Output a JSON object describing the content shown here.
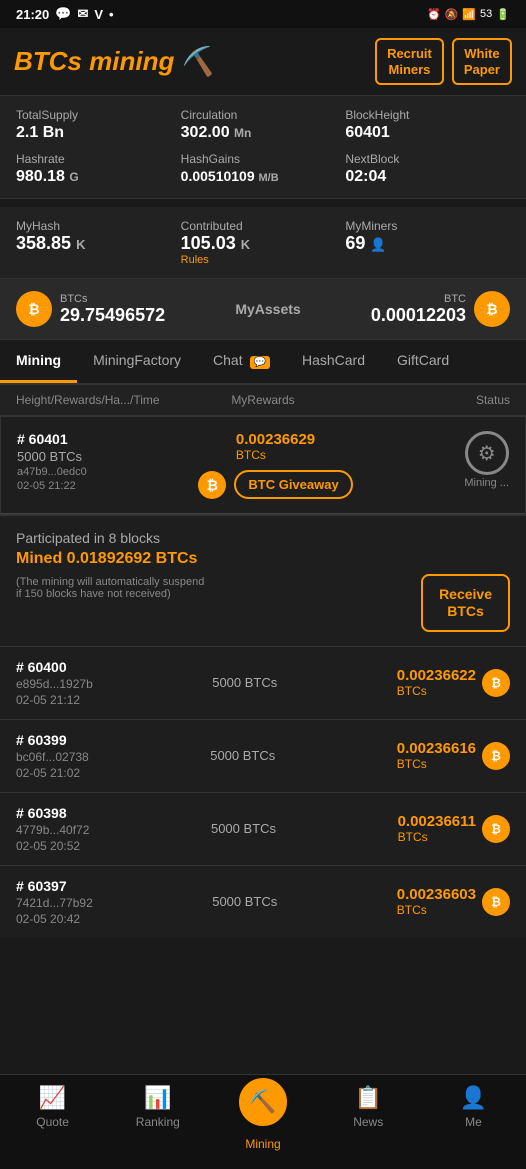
{
  "statusBar": {
    "time": "21:20",
    "icons": [
      "whatsapp",
      "message",
      "vpn",
      "dot",
      "alarm",
      "bell-off",
      "signal",
      "battery"
    ],
    "battery": "53"
  },
  "header": {
    "logo": "BTCs mining",
    "logo_emoji": "⛏️",
    "buttons": [
      {
        "id": "recruit-miners",
        "label": "Recruit\nMiners"
      },
      {
        "id": "white-paper",
        "label": "White\nPaper"
      }
    ]
  },
  "stats": [
    {
      "label": "TotalSupply",
      "value": "2.1 Bn",
      "unit": ""
    },
    {
      "label": "Circulation",
      "value": "302.00",
      "unit": "Mn"
    },
    {
      "label": "BlockHeight",
      "value": "60401",
      "unit": ""
    },
    {
      "label": "Hashrate",
      "value": "980.18",
      "unit": "G"
    },
    {
      "label": "HashGains",
      "value": "0.00510109",
      "unit": "M/B"
    },
    {
      "label": "NextBlock",
      "value": "02:04",
      "unit": ""
    }
  ],
  "mySection": [
    {
      "label": "MyHash",
      "value": "358.85",
      "unit": "K"
    },
    {
      "label": "Contributed",
      "value": "105.03",
      "unit": "K",
      "sub": "Rules"
    },
    {
      "label": "MyMiners",
      "value": "69",
      "unit": "👤"
    }
  ],
  "assets": {
    "left_label": "BTCs",
    "left_value": "29.75496572",
    "center_label": "MyAssets",
    "right_label": "BTC",
    "right_value": "0.00012203"
  },
  "tabs": [
    {
      "id": "mining",
      "label": "Mining",
      "active": true
    },
    {
      "id": "mining-factory",
      "label": "MiningFactory"
    },
    {
      "id": "chat",
      "label": "Chat",
      "badge": "💬"
    },
    {
      "id": "hashcard",
      "label": "HashCard"
    },
    {
      "id": "giftcard",
      "label": "GiftCard"
    }
  ],
  "subHeaders": [
    {
      "label": "Height/Rewards/Ha.../Time"
    },
    {
      "label": "MyRewards"
    },
    {
      "label": "Status"
    }
  ],
  "highlightedBlock": {
    "id": "#60401",
    "btcs": "5000 BTCs",
    "hash": "a47b9...0edc0",
    "time": "02-05 21:22",
    "amount": "0.00236629",
    "unit": "BTCs",
    "giveaway_label": "BTC Giveaway"
  },
  "participatedSection": {
    "label": "Participated in 8 blocks",
    "mined": "Mined 0.01892692 BTCs",
    "note": "(The mining will automatically suspend\nif 150 blocks have not received)",
    "button": "Receive\nBTCs"
  },
  "miningRows": [
    {
      "id": "#60400",
      "hash": "e895d...1927b",
      "btcs": "5000 BTCs",
      "time": "02-05 21:12",
      "amount": "0.00236622",
      "unit": "BTCs"
    },
    {
      "id": "#60399",
      "hash": "bc06f...02738",
      "btcs": "5000 BTCs",
      "time": "02-05 21:02",
      "amount": "0.00236616",
      "unit": "BTCs"
    },
    {
      "id": "#60398",
      "hash": "4779b...40f72",
      "btcs": "5000 BTCs",
      "time": "02-05 20:52",
      "amount": "0.00236611",
      "unit": "BTCs"
    },
    {
      "id": "#60397",
      "hash": "7421d...77b92",
      "btcs": "5000 BTCs",
      "time": "02-05 20:42",
      "amount": "0.00236603",
      "unit": "BTCs"
    }
  ],
  "bottomNav": [
    {
      "id": "quote",
      "label": "Quote",
      "icon": "📈",
      "active": false
    },
    {
      "id": "ranking",
      "label": "Ranking",
      "icon": "📊",
      "active": false
    },
    {
      "id": "mining",
      "label": "Mining",
      "icon": "⛏️",
      "active": true,
      "center": true
    },
    {
      "id": "news",
      "label": "News",
      "icon": "📋",
      "active": false
    },
    {
      "id": "me",
      "label": "Me",
      "icon": "👤",
      "active": false
    }
  ]
}
